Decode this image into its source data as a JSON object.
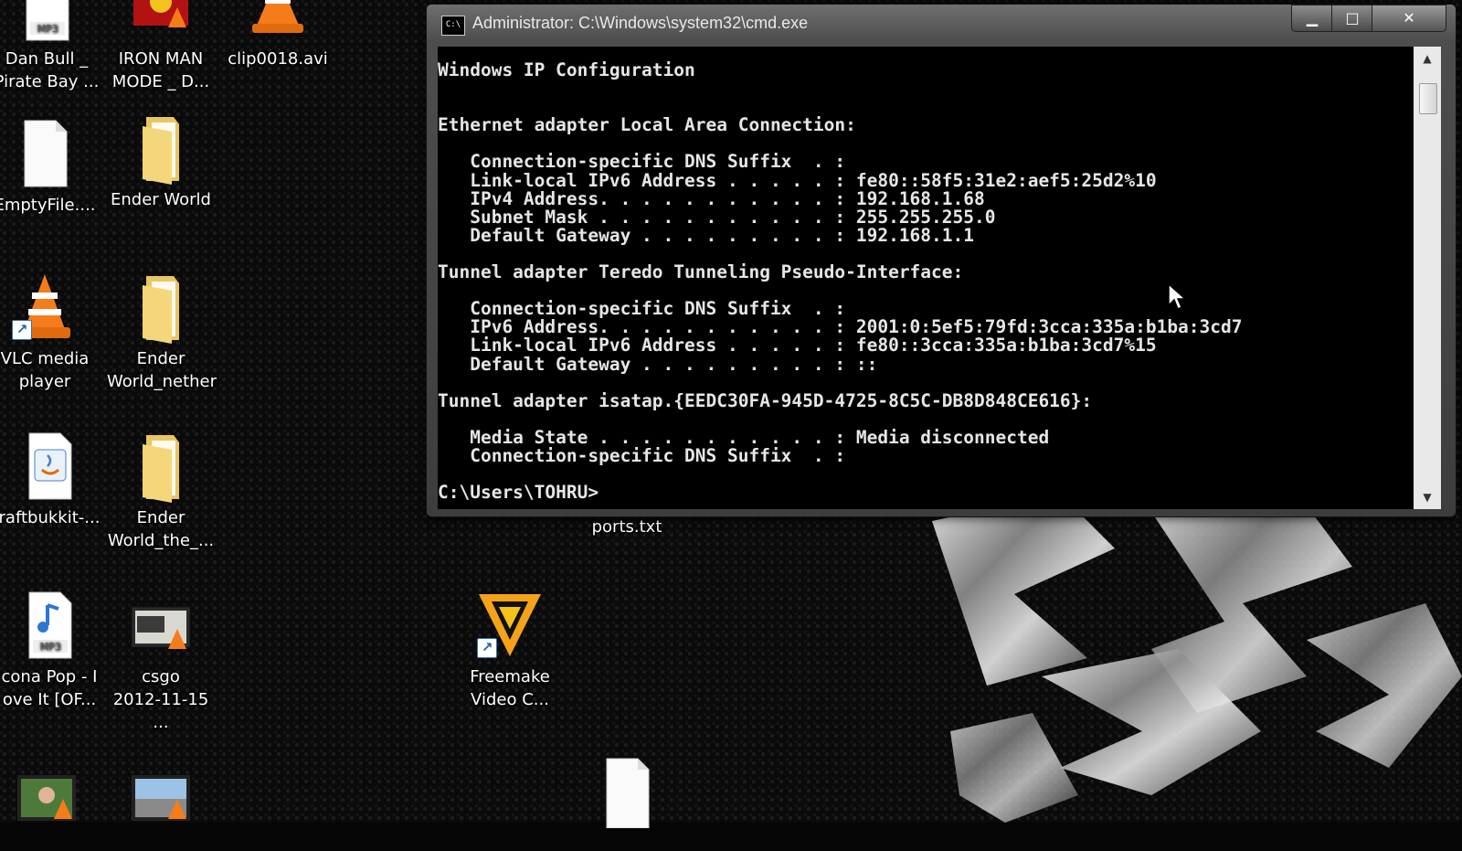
{
  "desktop": {
    "icons": [
      {
        "label": "Dan Bull _\nPirate Bay ...",
        "icon": "mp3-file-icon"
      },
      {
        "label": "IRON MAN\nMODE _ D...",
        "icon": "video-thumbnail-icon"
      },
      {
        "label": "clip0018.avi",
        "icon": "vlc-video-file-icon"
      },
      {
        "label": "EmptyFile....",
        "icon": "blank-file-icon"
      },
      {
        "label": "Ender World",
        "icon": "folder-icon"
      },
      {
        "label": "VLC media\nplayer",
        "icon": "vlc-cone-icon"
      },
      {
        "label": "Ender\nWorld_nether",
        "icon": "folder-icon"
      },
      {
        "label": "raftbukkit-...",
        "icon": "java-jar-icon"
      },
      {
        "label": "Ender\nWorld_the_...",
        "icon": "folder-icon"
      },
      {
        "label": "cona Pop - I\nove It [OF...",
        "icon": "mp3-file-icon"
      },
      {
        "label": "csgo\n2012-11-15 ...",
        "icon": "video-thumbnail-icon"
      },
      {
        "label": "Freemake\nVideo C...",
        "icon": "freemake-icon"
      },
      {
        "label": "ports.txt",
        "icon": "text-file-icon"
      }
    ],
    "mp3_badge": "MP3",
    "accent_colors": {
      "folder": "#f3d77a",
      "vlc": "#f47c1a",
      "freemake": "#f5a21b"
    }
  },
  "cmd": {
    "title": "Administrator: C:\\Windows\\system32\\cmd.exe",
    "icon_text": "C:\\",
    "buttons": {
      "minimize": "▁",
      "maximize": "□",
      "close": "✕"
    },
    "lines": [
      "Windows IP Configuration",
      "",
      "",
      "Ethernet adapter Local Area Connection:",
      "",
      "   Connection-specific DNS Suffix  . :",
      "   Link-local IPv6 Address . . . . . : fe80::58f5:31e2:aef5:25d2%10",
      "   IPv4 Address. . . . . . . . . . . : 192.168.1.68",
      "   Subnet Mask . . . . . . . . . . . : 255.255.255.0",
      "   Default Gateway . . . . . . . . . : 192.168.1.1",
      "",
      "Tunnel adapter Teredo Tunneling Pseudo-Interface:",
      "",
      "   Connection-specific DNS Suffix  . :",
      "   IPv6 Address. . . . . . . . . . . : 2001:0:5ef5:79fd:3cca:335a:b1ba:3cd7",
      "   Link-local IPv6 Address . . . . . : fe80::3cca:335a:b1ba:3cd7%15",
      "   Default Gateway . . . . . . . . . : ::",
      "",
      "Tunnel adapter isatap.{EEDC30FA-945D-4725-8C5C-DB8D848CE616}:",
      "",
      "   Media State . . . . . . . . . . . : Media disconnected",
      "   Connection-specific DNS Suffix  . :",
      "",
      "C:\\Users\\TOHRU>"
    ]
  }
}
